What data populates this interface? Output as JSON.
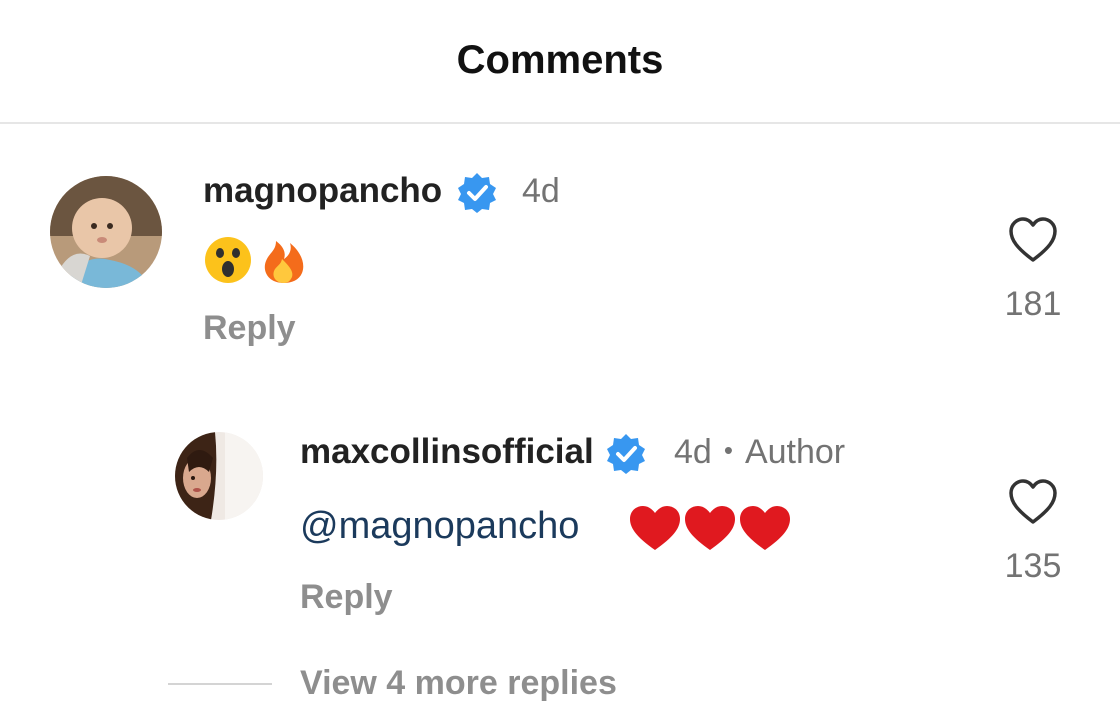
{
  "header": {
    "title": "Comments"
  },
  "comments": [
    {
      "username": "magnopancho",
      "verified": true,
      "time": "4d",
      "body_emojis": [
        "astonished-face",
        "fire"
      ],
      "reply_label": "Reply",
      "likes": "181"
    }
  ],
  "replies": [
    {
      "username": "maxcollinsofficial",
      "verified": true,
      "time": "4d",
      "author_tag": "Author",
      "mention": "@magnopancho",
      "body_emojis": [
        "red-heart",
        "red-heart",
        "red-heart"
      ],
      "reply_label": "Reply",
      "likes": "135"
    }
  ],
  "view_more_replies": "View 4 more replies",
  "colors": {
    "verified_blue": "#3897f0",
    "mention_blue": "#1b3a5c",
    "heart_red": "#e0191f",
    "muted_text": "#8e8e8e"
  }
}
